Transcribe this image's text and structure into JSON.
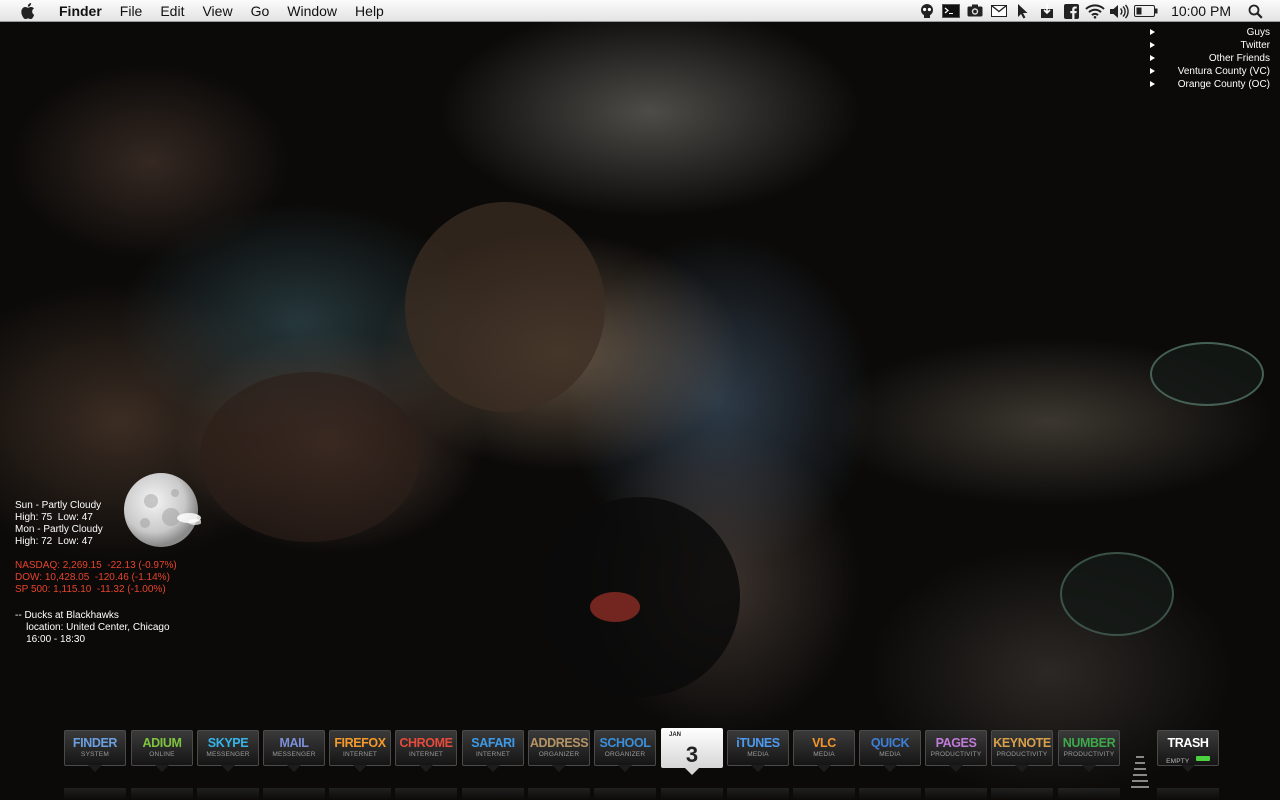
{
  "menubar": {
    "app_name": "Finder",
    "menus": [
      "File",
      "Edit",
      "View",
      "Go",
      "Window",
      "Help"
    ],
    "status_icons": [
      "alien-icon",
      "terminal-icon",
      "camera-icon",
      "gmail-icon",
      "cursor-icon",
      "download-icon",
      "facebook-icon",
      "wifi-icon",
      "volume-icon",
      "battery-icon"
    ],
    "clock": "10:00 PM"
  },
  "friends_list": {
    "items": [
      "Guys",
      "Twitter",
      "Other Friends",
      "Ventura County (VC)",
      "Orange County (OC)"
    ]
  },
  "weather": {
    "line1": "Sun - Partly Cloudy",
    "line2": "High: 75  Low: 47",
    "line3": "Mon - Partly Cloudy",
    "line4": "High: 72  Low: 47"
  },
  "stocks": {
    "nasdaq": "NASDAQ: 2,269.15  -22.13 (-0.97%)",
    "dow": "DOW: 10,428.05  -120.46 (-1.14%)",
    "sp500": "SP 500: 1,115.10  -11.32 (-1.00%)"
  },
  "event": {
    "title": "-- Ducks at Blackhawks",
    "location": "    location: United Center, Chicago",
    "time": "    16:00 - 18:30"
  },
  "dock": {
    "items": [
      {
        "name": "FINDER",
        "sub": "SYSTEM",
        "color": "#6a9fe0"
      },
      {
        "name": "ADIUM",
        "sub": "ONLINE",
        "color": "#7fc43f"
      },
      {
        "name": "SKYPE",
        "sub": "MESSENGER",
        "color": "#35b5e8"
      },
      {
        "name": "MAIL",
        "sub": "MESSENGER",
        "color": "#7b8fd6"
      },
      {
        "name": "FIREFOX",
        "sub": "INTERNET",
        "color": "#f39a2b"
      },
      {
        "name": "CHROME",
        "sub": "INTERNET",
        "color": "#e64a3b"
      },
      {
        "name": "SAFARI",
        "sub": "INTERNET",
        "color": "#3e9ae6"
      },
      {
        "name": "ADDRESS",
        "sub": "ORGANIZER",
        "color": "#b69464"
      },
      {
        "name": "SCHOOL",
        "sub": "ORGANIZER",
        "color": "#3b8fd8"
      },
      {
        "name": "iTUNES",
        "sub": "MEDIA",
        "color": "#4c9bf0"
      },
      {
        "name": "VLC",
        "sub": "MEDIA",
        "color": "#f3952c"
      },
      {
        "name": "QUICK",
        "sub": "MEDIA",
        "color": "#3d7fd6"
      },
      {
        "name": "PAGES",
        "sub": "PRODUCTIVITY",
        "color": "#c07ad8"
      },
      {
        "name": "KEYNOTE",
        "sub": "PRODUCTIVITY",
        "color": "#d8a04a"
      },
      {
        "name": "NUMBER",
        "sub": "PRODUCTIVITY",
        "color": "#3ea84a"
      }
    ],
    "calendar": {
      "month": "JAN",
      "day": "3"
    },
    "trash": {
      "name": "TRASH",
      "sub": "EMPTY",
      "color": "#ffffff"
    }
  }
}
